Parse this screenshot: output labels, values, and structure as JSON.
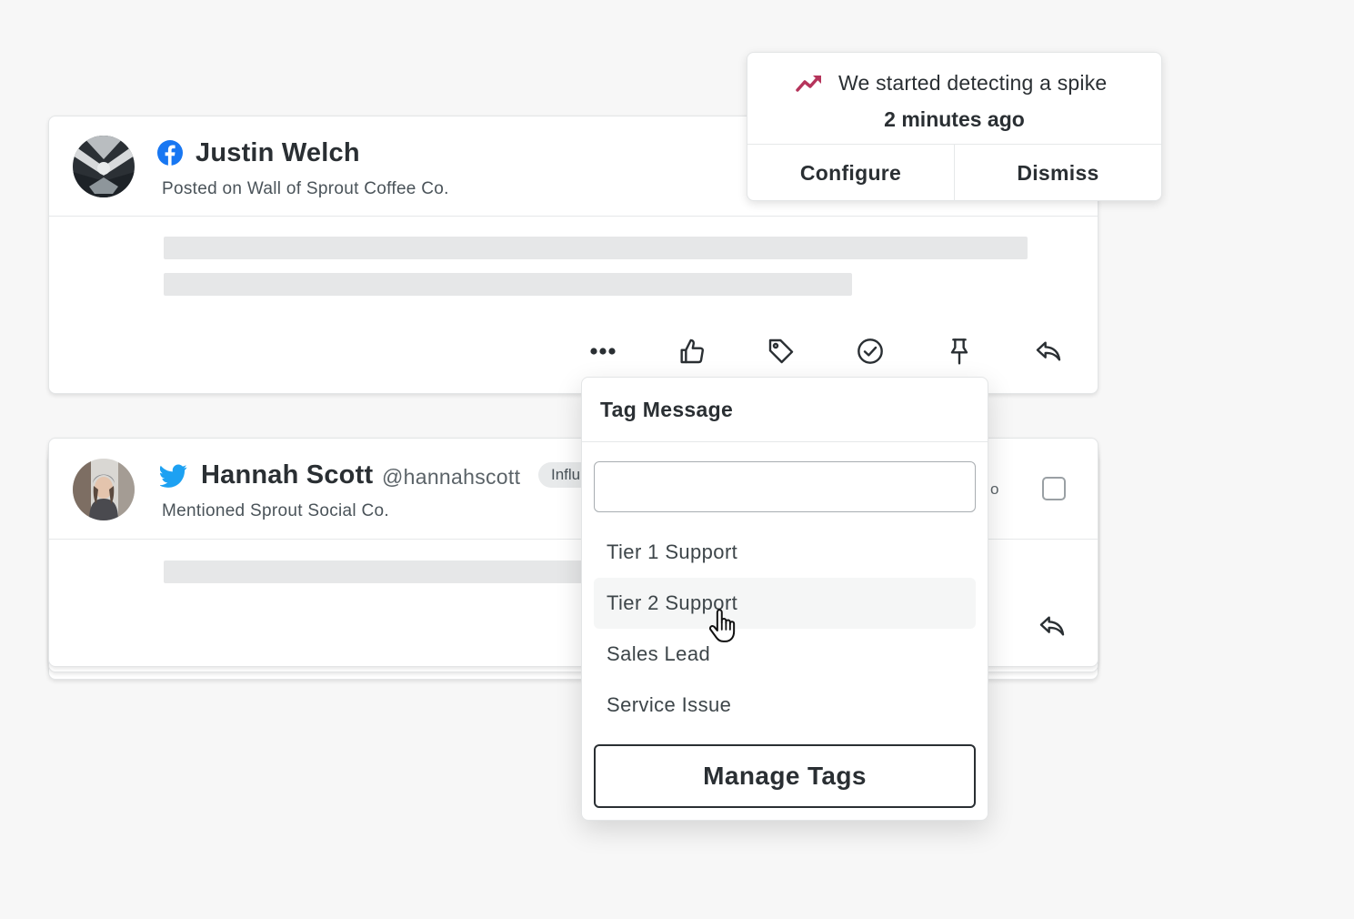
{
  "posts": [
    {
      "network": "facebook-icon",
      "author": "Justin Welch",
      "subtitle": "Posted on Wall of Sprout Coffee Co."
    },
    {
      "network": "twitter-icon",
      "author": "Hannah Scott",
      "handle": "@hannahscott",
      "badge": "Influ",
      "time_fragment": "o",
      "subtitle": "Mentioned Sprout Social Co."
    }
  ],
  "actions": [
    "more-icon",
    "like-icon",
    "tag-icon",
    "complete-icon",
    "pin-icon",
    "reply-icon"
  ],
  "notification": {
    "message": "We started detecting a spike",
    "time": "2 minutes ago",
    "configure_label": "Configure",
    "dismiss_label": "Dismiss",
    "accent_color": "#b5345b"
  },
  "tag_menu": {
    "title": "Tag Message",
    "search_value": "",
    "items": [
      "Tier 1 Support",
      "Tier 2 Support",
      "Sales Lead",
      "Service Issue"
    ],
    "hovered_item": "Tier 2 Support",
    "manage_label": "Manage Tags"
  },
  "colors": {
    "facebook": "#1877f2",
    "twitter": "#1da1f2",
    "text": "#2a2f33"
  }
}
